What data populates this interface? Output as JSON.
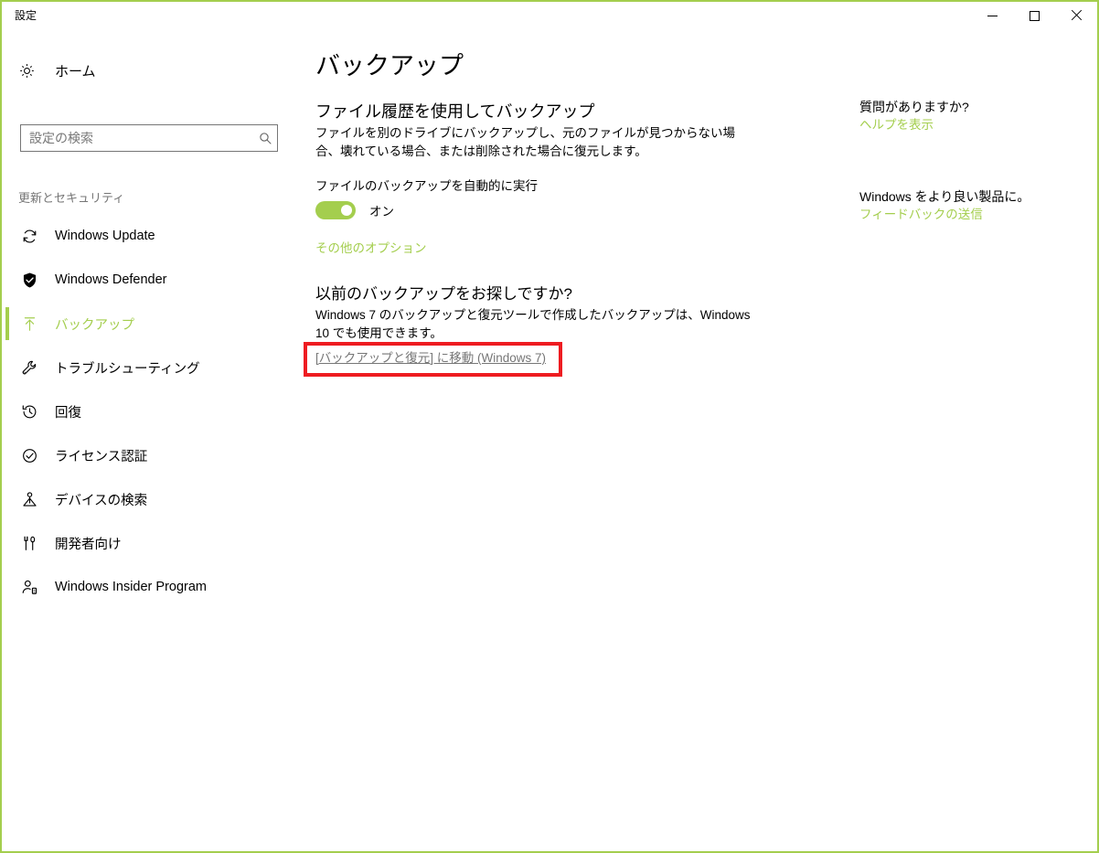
{
  "window": {
    "title": "設定",
    "accent_color": "#A4CE4E",
    "highlight_color": "#EE1C21",
    "controls": {
      "minimize": "minimize-icon",
      "maximize": "maximize-icon",
      "close": "close-icon"
    }
  },
  "sidebar": {
    "home": {
      "label": "ホーム",
      "icon": "gear-icon"
    },
    "search": {
      "placeholder": "設定の検索",
      "value": "",
      "icon": "search-icon"
    },
    "group_header": "更新とセキュリティ",
    "items": [
      {
        "label": "Windows Update",
        "icon": "refresh-icon",
        "selected": false
      },
      {
        "label": "Windows Defender",
        "icon": "shield-icon",
        "selected": false
      },
      {
        "label": "バックアップ",
        "icon": "upload-arrow-icon",
        "selected": true
      },
      {
        "label": "トラブルシューティング",
        "icon": "wrench-icon",
        "selected": false
      },
      {
        "label": "回復",
        "icon": "history-clock-icon",
        "selected": false
      },
      {
        "label": "ライセンス認証",
        "icon": "check-circle-icon",
        "selected": false
      },
      {
        "label": "デバイスの検索",
        "icon": "find-device-icon",
        "selected": false
      },
      {
        "label": "開発者向け",
        "icon": "tools-icon",
        "selected": false
      },
      {
        "label": "Windows Insider Program",
        "icon": "person-insider-icon",
        "selected": false
      }
    ]
  },
  "main": {
    "page_title": "バックアップ",
    "section_file_history": {
      "title": "ファイル履歴を使用してバックアップ",
      "description": "ファイルを別のドライブにバックアップし、元のファイルが見つからない場合、壊れている場合、または削除された場合に復元します。",
      "toggle_label": "ファイルのバックアップを自動的に実行",
      "toggle_state": "オン",
      "toggle_on": true,
      "more_options_link": "その他のオプション"
    },
    "section_legacy": {
      "title": "以前のバックアップをお探しですか?",
      "description": "Windows 7 のバックアップと復元ツールで作成したバックアップは、Windows 10 でも使用できます。",
      "link": "[バックアップと復元] に移動 (Windows 7)"
    }
  },
  "rail": {
    "block_help": {
      "heading": "質問がありますか?",
      "link": "ヘルプを表示"
    },
    "block_feedback": {
      "heading": "Windows をより良い製品に。",
      "link": "フィードバックの送信"
    }
  }
}
